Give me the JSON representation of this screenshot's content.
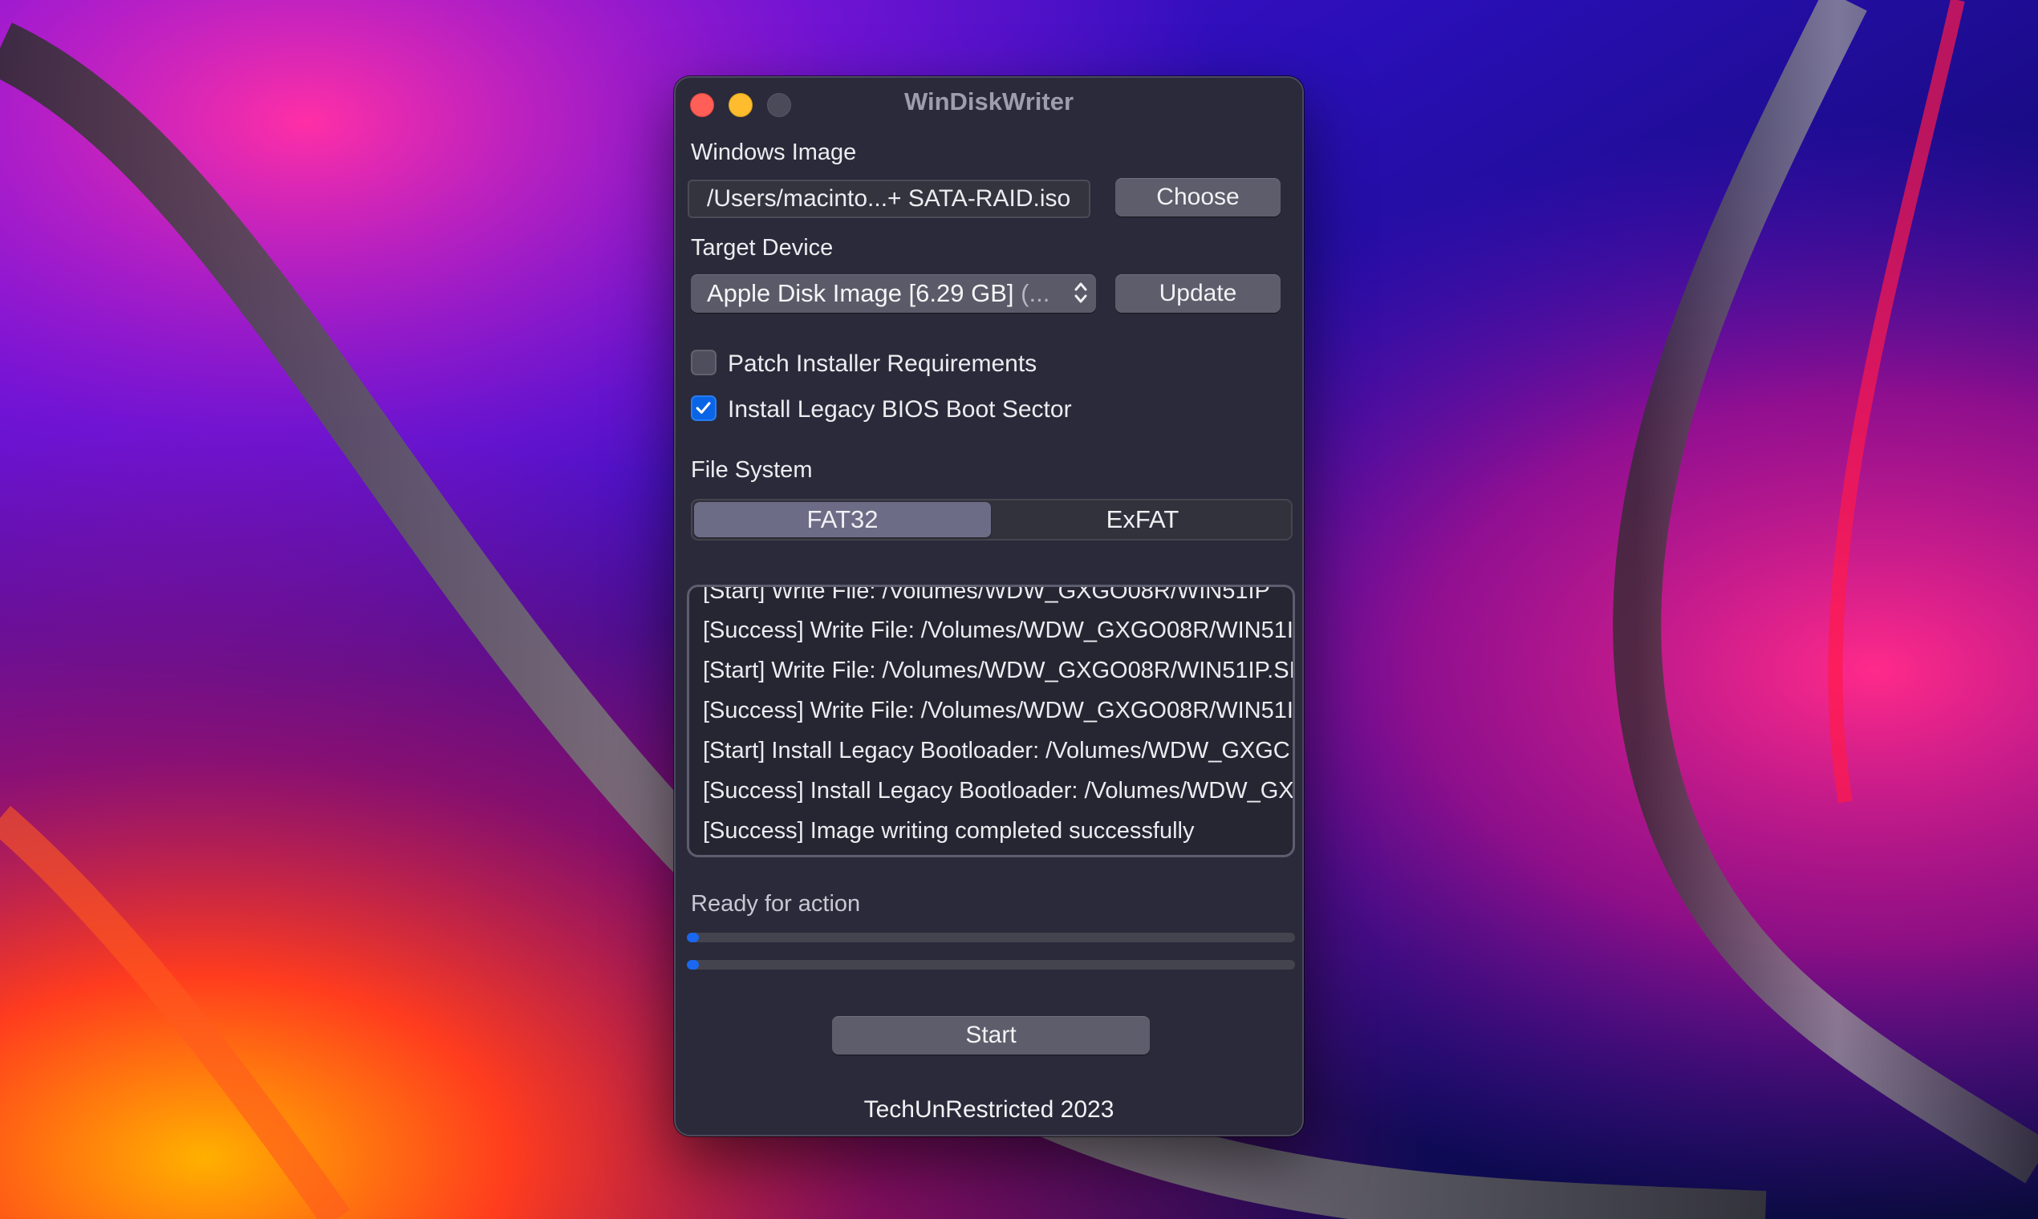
{
  "window": {
    "title": "WinDiskWriter"
  },
  "windows_image": {
    "label": "Windows Image",
    "path_value": "/Users/macinto...+ SATA-RAID.iso",
    "choose_label": "Choose"
  },
  "target_device": {
    "label": "Target Device",
    "selected_main": "Apple Disk Image [6.29 GB] ",
    "selected_suffix": "(...",
    "update_label": "Update"
  },
  "options": {
    "patch_label": "Patch Installer Requirements",
    "patch_checked": false,
    "legacy_label": "Install Legacy BIOS Boot Sector",
    "legacy_checked": true
  },
  "file_system": {
    "label": "File System",
    "options": [
      "FAT32",
      "ExFAT"
    ],
    "selected": "FAT32"
  },
  "log": {
    "lines": [
      "[Start] Write File: /Volumes/WDW_GXGO08R/WIN51IP",
      "[Success] Write File: /Volumes/WDW_GXGO08R/WIN51I",
      "[Start] Write File: /Volumes/WDW_GXGO08R/WIN51IP.SI",
      "[Success] Write File: /Volumes/WDW_GXGO08R/WIN51I",
      "[Start] Install Legacy Bootloader: /Volumes/WDW_GXGC",
      "[Success] Install Legacy Bootloader: /Volumes/WDW_GX",
      "[Success] Image writing completed successfully"
    ]
  },
  "status": {
    "text": "Ready for action",
    "progress_primary": 0.02,
    "progress_secondary": 0.02
  },
  "start_label": "Start",
  "footer": "TechUnRestricted 2023",
  "colors": {
    "accent": "#0a64e6",
    "window_bg": "#2a2a3a",
    "close": "#ff5f57",
    "minimize": "#febc2e"
  }
}
